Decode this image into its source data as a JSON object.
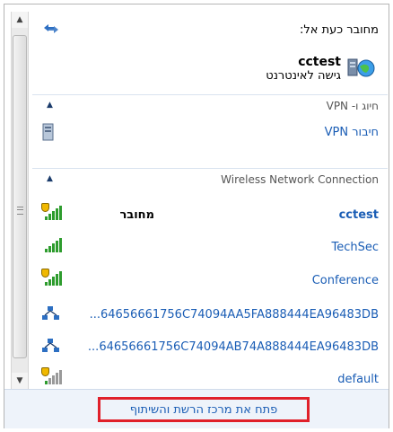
{
  "header": {
    "connected_to": "מחובר כעת אל:",
    "network_name": "cctest",
    "network_access": "גישה לאינטרנט"
  },
  "vpn_section": {
    "title": "חיוג ו- VPN",
    "items": [
      {
        "label": "חיבור VPN"
      }
    ]
  },
  "wireless_section": {
    "title": "Wireless Network Connection",
    "items": [
      {
        "label": "cctest",
        "status": "מחובר",
        "secured": true,
        "signal": 5
      },
      {
        "label": "TechSec",
        "secured": false,
        "signal": 5
      },
      {
        "label": "Conference",
        "secured": true,
        "signal": 5
      },
      {
        "label": "...64656661756C74094AA5FA888444EA96483DB",
        "type": "adhoc"
      },
      {
        "label": "...64656661756C74094AB74A888444EA96483DB",
        "type": "adhoc"
      },
      {
        "label": "default",
        "secured": true,
        "signal": 1
      }
    ]
  },
  "footer": {
    "link": "פתח את מרכז הרשת והשיתוף"
  },
  "colors": {
    "link": "#1a5db5",
    "highlight_box": "#e0202a",
    "signal": "#2e9c2e"
  }
}
